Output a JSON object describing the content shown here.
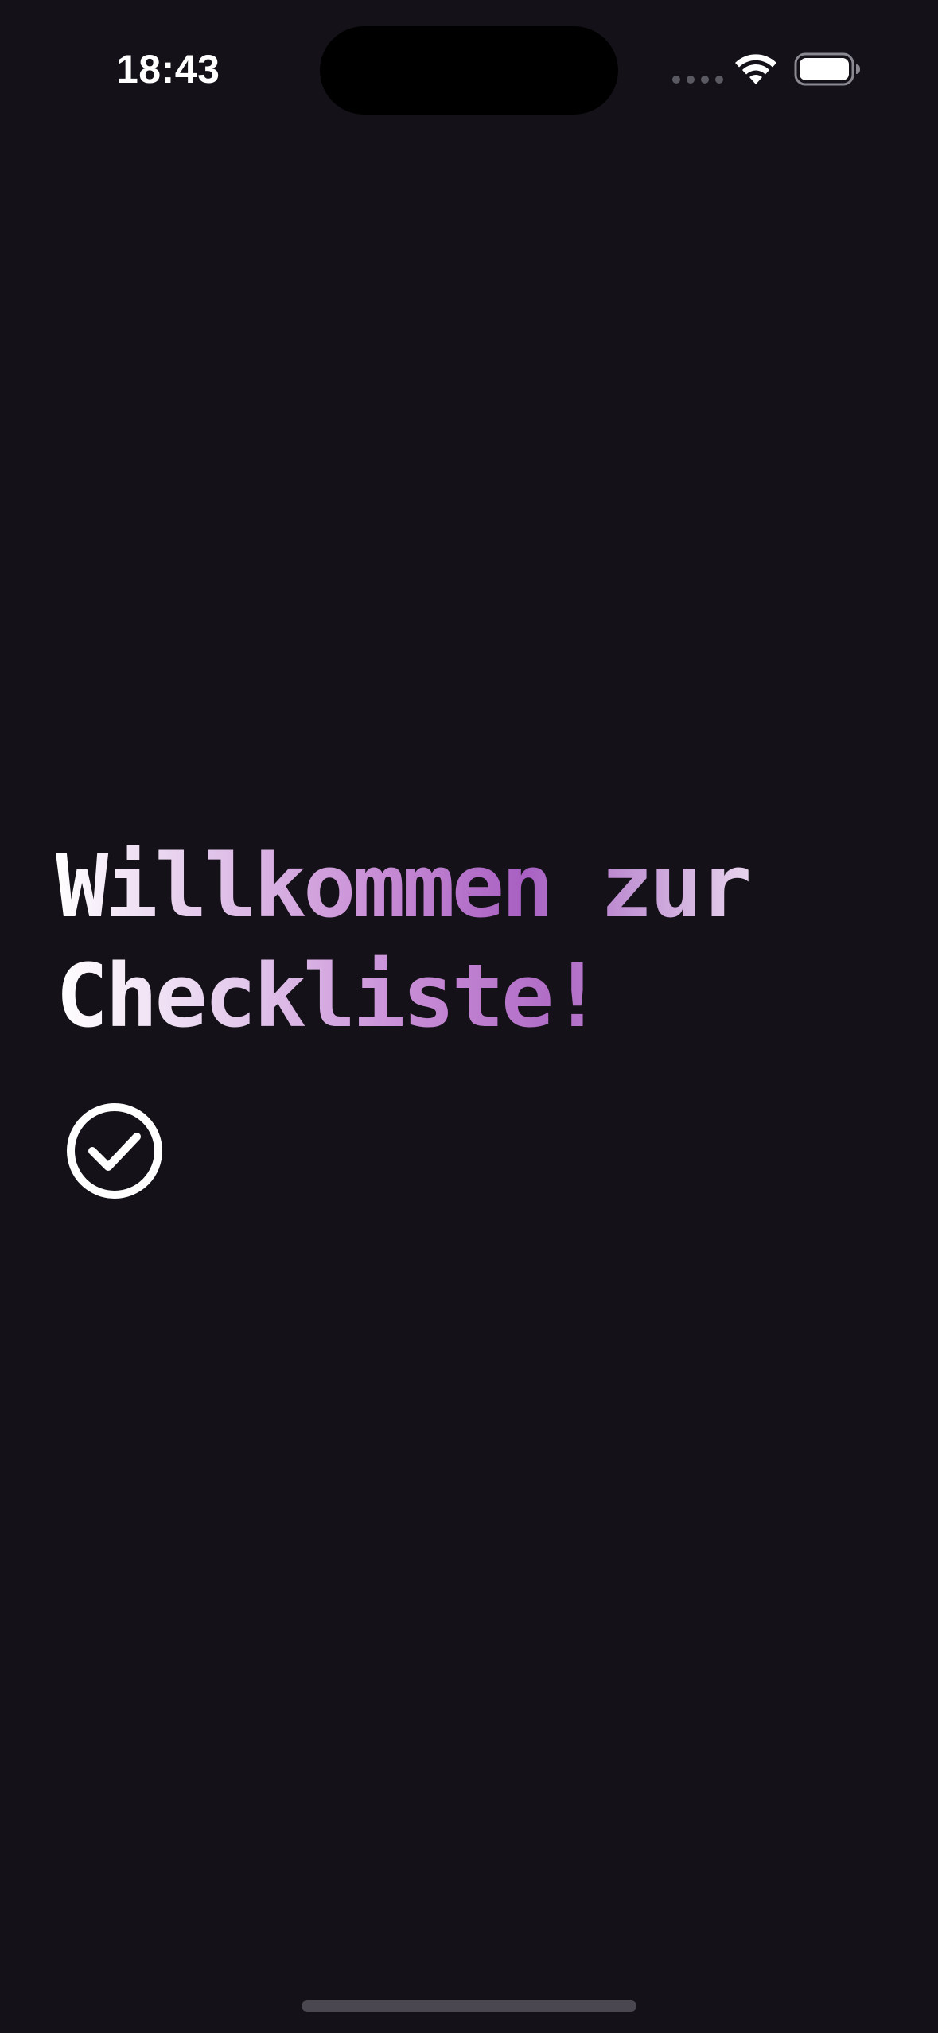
{
  "status_bar": {
    "time": "18:43"
  },
  "icons": {
    "wifi": "wifi-icon",
    "battery": "battery-icon",
    "check": "check-circle-icon"
  },
  "welcome": {
    "title_line1": "Willkommen zur",
    "title_line2": "Checkliste!"
  },
  "colors": {
    "background": "#141118",
    "accent": "#a860c2"
  }
}
